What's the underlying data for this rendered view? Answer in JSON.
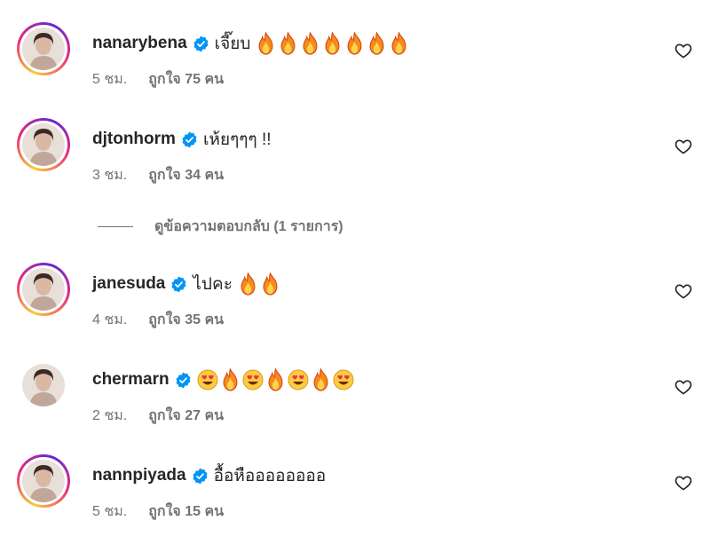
{
  "comments": [
    {
      "username": "nanarybena",
      "text": "เจี๊ยบ",
      "emoji": [
        "fire",
        "fire",
        "fire",
        "fire",
        "fire",
        "fire",
        "fire"
      ],
      "time": "5 ชม.",
      "likes": "ถูกใจ 75 คน",
      "ring": true
    },
    {
      "username": "djtonhorm",
      "text": "เห้ยๆๆๆ !!",
      "emoji": [],
      "time": "3 ชม.",
      "likes": "ถูกใจ 34 คน",
      "ring": true
    },
    {
      "username": "janesuda",
      "text": "ไปคะ",
      "emoji": [
        "fire",
        "fire"
      ],
      "time": "4 ชม.",
      "likes": "ถูกใจ 35 คน",
      "ring": true
    },
    {
      "username": "chermarn",
      "text": "",
      "emoji": [
        "heart-eyes",
        "fire",
        "heart-eyes",
        "fire",
        "heart-eyes",
        "fire",
        "heart-eyes"
      ],
      "time": "2 ชม.",
      "likes": "ถูกใจ 27 คน",
      "ring": false
    },
    {
      "username": "nannpiyada",
      "text": "อื้อหืออออออออ",
      "emoji": [],
      "time": "5 ชม.",
      "likes": "ถูกใจ 15 คน",
      "ring": true
    }
  ],
  "replies_link": "ดูข้อความตอบกลับ (1 รายการ)",
  "colors": {
    "verified": "#0095f6",
    "muted": "#737373",
    "text": "#262626"
  }
}
